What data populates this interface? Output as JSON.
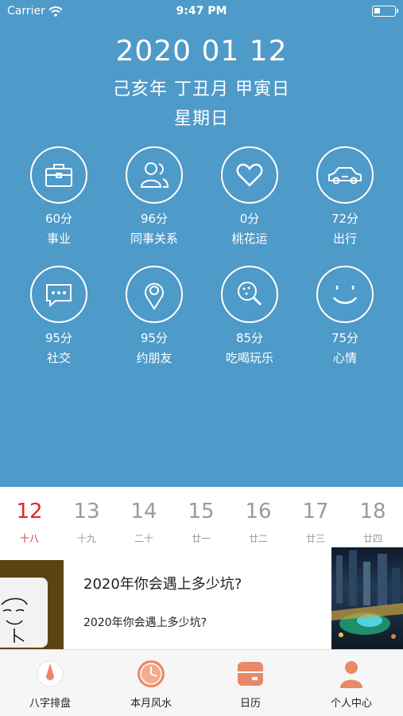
{
  "status_bar": {
    "carrier": "Carrier",
    "time": "9:47 PM"
  },
  "header": {
    "date": "2020 01 12",
    "lunar": "己亥年 丁丑月 甲寅日",
    "weekday": "星期日"
  },
  "fortunes": [
    {
      "score": "60分",
      "label": "事业",
      "icon": "briefcase-icon"
    },
    {
      "score": "96分",
      "label": "同事关系",
      "icon": "people-icon"
    },
    {
      "score": "0分",
      "label": "桃花运",
      "icon": "heart-icon"
    },
    {
      "score": "72分",
      "label": "出行",
      "icon": "car-icon"
    },
    {
      "score": "95分",
      "label": "社交",
      "icon": "chat-icon"
    },
    {
      "score": "95分",
      "label": "约朋友",
      "icon": "location-pin-icon"
    },
    {
      "score": "85分",
      "label": "吃喝玩乐",
      "icon": "magnifier-icon"
    },
    {
      "score": "75分",
      "label": "心情",
      "icon": "smiley-icon"
    }
  ],
  "days": [
    {
      "num": "12",
      "lunar": "十八",
      "active": true
    },
    {
      "num": "13",
      "lunar": "十九"
    },
    {
      "num": "14",
      "lunar": "二十"
    },
    {
      "num": "15",
      "lunar": "廿一"
    },
    {
      "num": "16",
      "lunar": "廿二"
    },
    {
      "num": "17",
      "lunar": "廿三"
    },
    {
      "num": "18",
      "lunar": "廿四"
    }
  ],
  "article": {
    "title": "2020年你会遇上多少坑?",
    "subtitle": "2020年你会遇上多少坑?"
  },
  "tabs": [
    {
      "label": "八字排盘",
      "icon": "compass-needle-icon"
    },
    {
      "label": "本月风水",
      "icon": "clock-icon"
    },
    {
      "label": "日历",
      "icon": "calendar-icon"
    },
    {
      "label": "个人中心",
      "icon": "user-icon"
    }
  ],
  "colors": {
    "header_bg": "#4e9ac8",
    "accent": "#e2242c",
    "tab_icon": "#e8896a"
  }
}
